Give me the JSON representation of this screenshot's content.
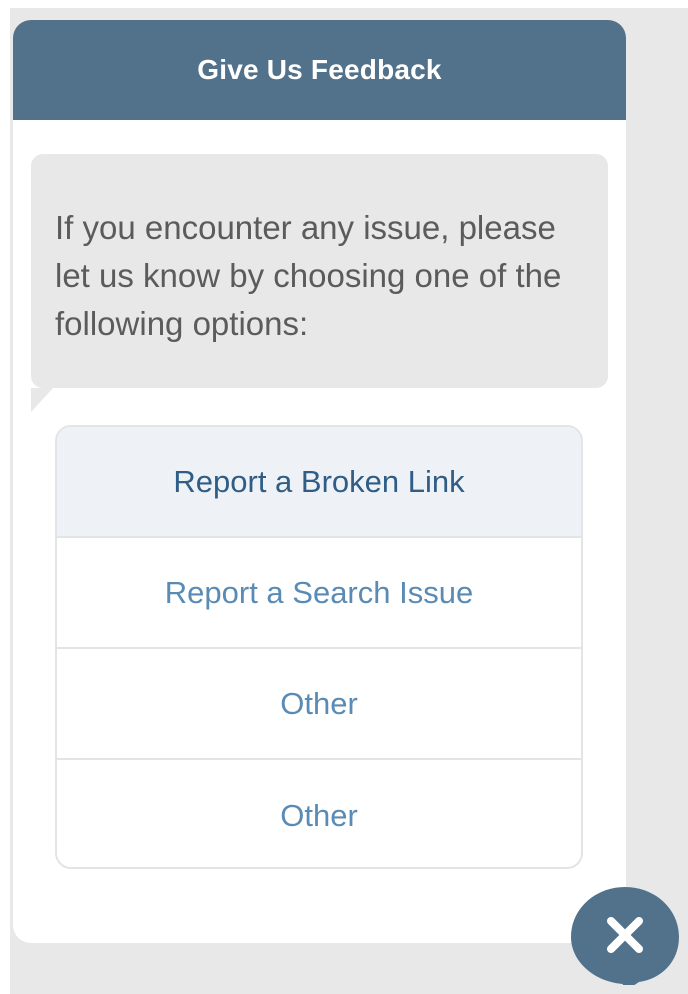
{
  "header": {
    "title": "Give Us Feedback"
  },
  "message": {
    "text": "If you encounter any issue, please let us know by choosing one of the following options:"
  },
  "options": [
    {
      "label": "Report a Broken Link"
    },
    {
      "label": "Report a Search Issue"
    },
    {
      "label": "Other"
    },
    {
      "label": "Other"
    }
  ],
  "close_button": {
    "icon": "close-icon"
  },
  "colors": {
    "header": "#52728c",
    "bubble": "#e8e8e8",
    "option_text": "#5a8bb5",
    "option_text_active": "#2f5d86",
    "fab": "#52728c"
  }
}
